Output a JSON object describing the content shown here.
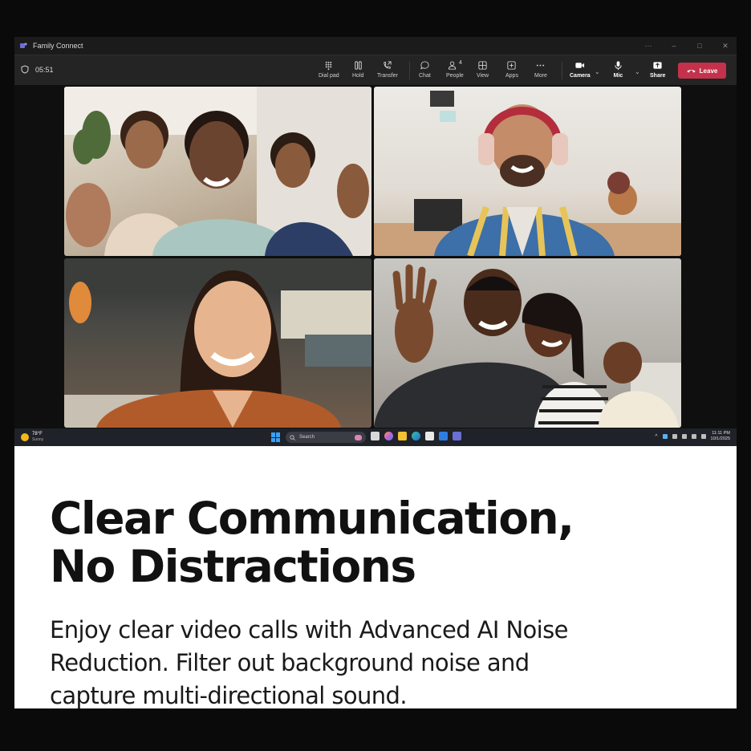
{
  "window": {
    "app_title": "Family Connect",
    "more_options": "···"
  },
  "toolbar": {
    "call_timer": "05:51",
    "buttons": [
      {
        "label": "Dial pad",
        "icon": "dialpad-icon"
      },
      {
        "label": "Hold",
        "icon": "hold-icon"
      },
      {
        "label": "Transfer",
        "icon": "transfer-icon"
      },
      {
        "label": "Chat",
        "icon": "chat-icon"
      },
      {
        "label": "People",
        "icon": "people-icon",
        "count": "4"
      },
      {
        "label": "View",
        "icon": "view-icon"
      },
      {
        "label": "Apps",
        "icon": "apps-icon"
      },
      {
        "label": "More",
        "icon": "more-icon"
      },
      {
        "label": "Camera",
        "icon": "camera-icon"
      },
      {
        "label": "Mic",
        "icon": "mic-icon"
      },
      {
        "label": "Share",
        "icon": "share-icon"
      }
    ],
    "leave_label": "Leave",
    "leave_color": "#c4314b"
  },
  "participants": [
    {
      "name": "family-group-tile"
    },
    {
      "name": "man-headphones-tile"
    },
    {
      "name": "woman-smiling-tile"
    },
    {
      "name": "family-waving-tile"
    }
  ],
  "taskbar": {
    "weather_temp": "78°F",
    "weather_condition": "Sunny",
    "search_placeholder": "Search",
    "time": "11:11 PM",
    "date": "10/1/2025"
  },
  "marketing": {
    "headline_line1": "Clear Communication,",
    "headline_line2": "No Distractions",
    "body_line1": "Enjoy clear video calls with Advanced AI Noise",
    "body_line2": "Reduction. Filter out background noise and",
    "body_line3": "capture multi-directional sound."
  }
}
